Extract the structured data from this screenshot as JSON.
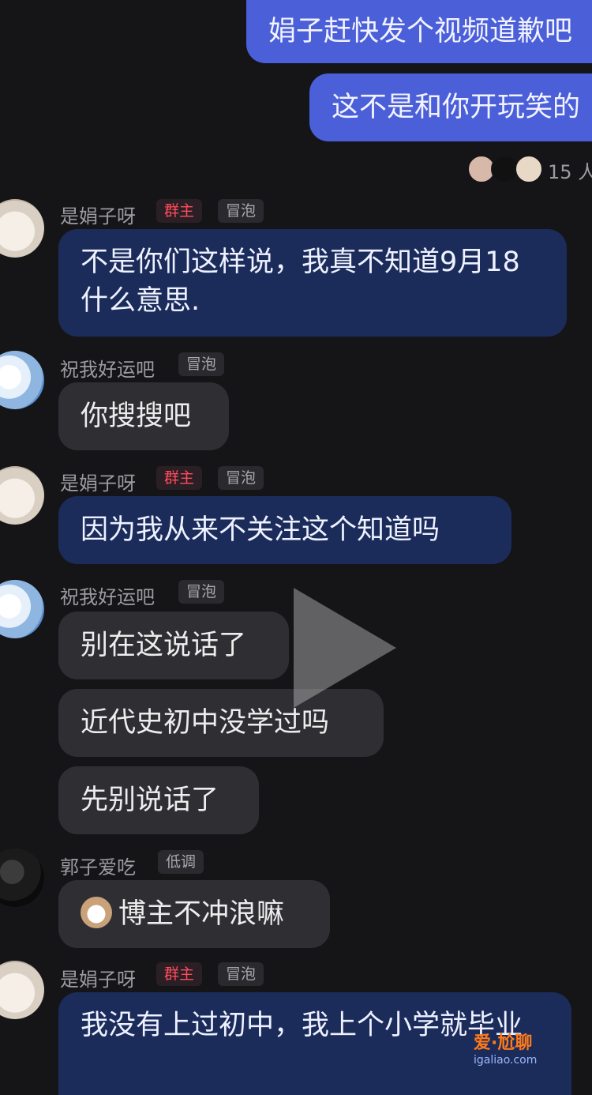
{
  "messages_top": [
    {
      "text": "娟子赶快发个视频道歉吧"
    },
    {
      "text": "这不是和你开玩笑的"
    }
  ],
  "read_receipt": {
    "count_label": "15 人"
  },
  "badges": {
    "owner": "群主",
    "bubble": "冒泡",
    "lowkey": "低调"
  },
  "users": {
    "juanzi": "是娟子呀",
    "zhuwo": "祝我好运吧",
    "guozi": "郭子爱吃"
  },
  "msgs": {
    "m1": "不是你们这样说，我真不知道9月18什么意思.",
    "m2": "你搜搜吧",
    "m3": "因为我从来不关注这个知道吗",
    "m4": "别在这说话了",
    "m5": "近代史初中没学过吗",
    "m6": "先别说话了",
    "m7": "博主不冲浪嘛",
    "m8": "我没有上过初中，我上个小学就毕业"
  },
  "watermark": {
    "brand": "爱·尬聊",
    "url": "igaliao.com"
  }
}
